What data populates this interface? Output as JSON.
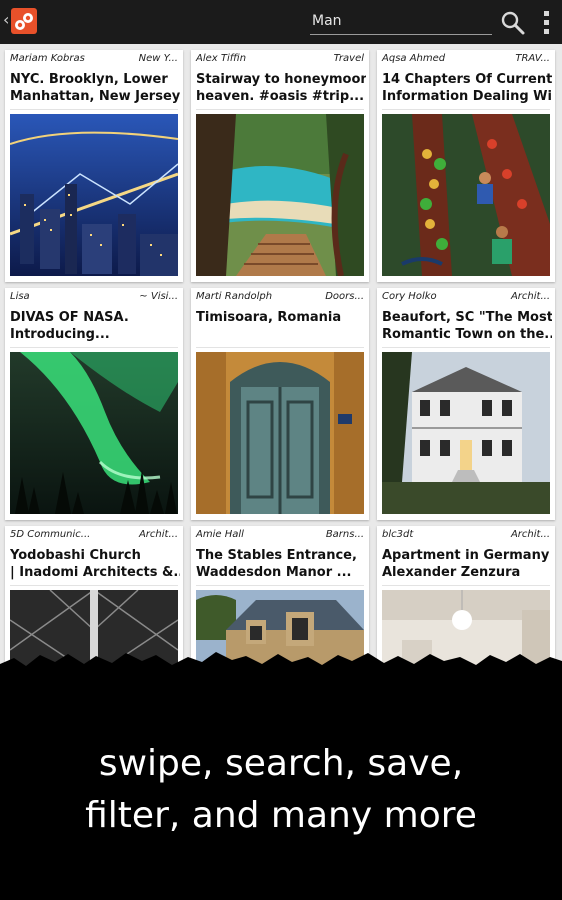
{
  "header": {
    "back_icon": "chevron-left-icon",
    "logo_icon": "app-logo-icon",
    "search": {
      "value": "Man",
      "placeholder": ""
    },
    "search_icon": "search-icon",
    "menu_icon": "overflow-menu-icon",
    "accent": "#e8512a"
  },
  "cards": [
    {
      "author": "Mariam Kobras",
      "category": "New Y...",
      "title_lines": [
        "NYC. Brooklyn, Lower",
        "Manhattan, New Jersey..."
      ],
      "image": "night-city-bridges-photo"
    },
    {
      "author": "Alex Tiffin",
      "category": "Travel",
      "title_lines": [
        "Stairway to honeymoon",
        "heaven. #oasis #trip..."
      ],
      "image": "tropical-stairway-photo"
    },
    {
      "author": "Aqsa Ahmed",
      "category": "TRAV...",
      "title_lines": [
        "14 Chapters Of Current",
        "Information Dealing Wit..."
      ],
      "image": "floating-market-photo"
    },
    {
      "author": "Lisa",
      "category": "~ Visi...",
      "title_lines": [
        "DIVAS OF NASA.",
        "Introducing..."
      ],
      "image": "aurora-borealis-photo"
    },
    {
      "author": "Marti Randolph",
      "category": "Doors...",
      "title_lines": [
        "Timisoara, Romania"
      ],
      "image": "ornate-green-door-photo"
    },
    {
      "author": "Cory Holko",
      "category": "Archit...",
      "title_lines": [
        "Beaufort, SC \"The Most",
        "Romantic Town on the..."
      ],
      "image": "southern-mansion-photo"
    },
    {
      "author": "5D Communic...",
      "category": "Archit...",
      "title_lines": [
        "Yodobashi Church",
        "| Inadomi Architects &..."
      ],
      "image": "church-ceiling-photo"
    },
    {
      "author": "Amie Hall",
      "category": "Barns...",
      "title_lines": [
        "The Stables Entrance,",
        "Waddesdon Manor ..."
      ],
      "image": "stables-manor-photo"
    },
    {
      "author": "blc3dt",
      "category": "Archit...",
      "title_lines": [
        "Apartment in Germany by",
        "Alexander Zenzura"
      ],
      "image": "apartment-interior-photo"
    }
  ],
  "caption": {
    "lines": [
      "swipe, search, save,",
      "filter, and many more"
    ]
  }
}
